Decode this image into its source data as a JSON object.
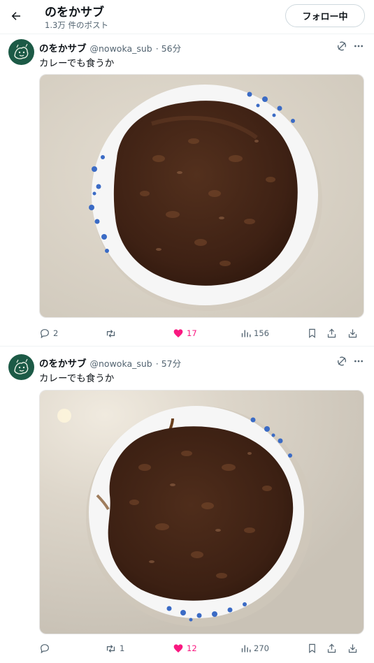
{
  "header": {
    "title": "のをかサブ",
    "post_count": "1.3万 件のポスト",
    "follow_label": "フォロー中"
  },
  "posts": [
    {
      "name": "のをかサブ",
      "handle": "@nowoka_sub",
      "time": "· 56分",
      "text": "カレーでも食うか",
      "replies": "2",
      "reposts": "",
      "likes": "17",
      "views": "156",
      "liked": true
    },
    {
      "name": "のをかサブ",
      "handle": "@nowoka_sub",
      "time": "· 57分",
      "text": "カレーでも食うか",
      "replies": "",
      "reposts": "1",
      "likes": "12",
      "views": "270",
      "liked": true
    }
  ],
  "colors": {
    "like": "#f91880",
    "muted": "#536471",
    "avatar_bg": "#1c5a46",
    "curry": "#3e2114"
  },
  "icons": [
    "back-arrow-icon",
    "grok-icon",
    "more-icon",
    "reply-icon",
    "repost-icon",
    "heart-icon",
    "views-icon",
    "bookmark-icon",
    "share-icon",
    "download-icon"
  ]
}
